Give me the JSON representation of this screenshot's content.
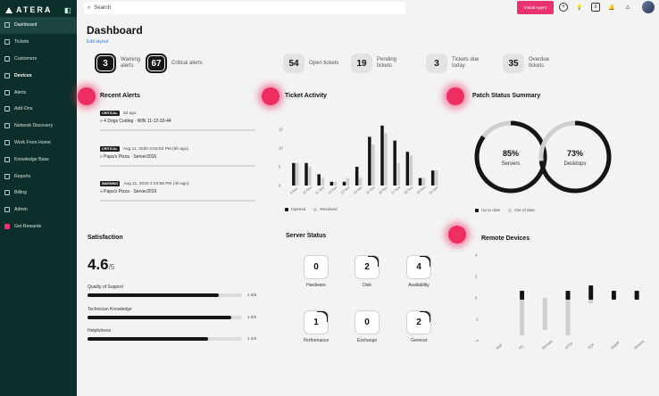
{
  "app": {
    "logo_text": "ATERA"
  },
  "sidebar": {
    "items": [
      {
        "label": "Dashboard",
        "icon": "grid-icon",
        "active": true
      },
      {
        "label": "Tickets",
        "icon": "ticket-icon"
      },
      {
        "label": "Customers",
        "icon": "users-icon"
      },
      {
        "label": "Devices",
        "icon": "monitor-icon",
        "bold": true
      },
      {
        "label": "Alerts",
        "icon": "warning-icon"
      },
      {
        "label": "Add-Ons",
        "icon": "puzzle-icon"
      },
      {
        "label": "Network Discovery",
        "icon": "network-icon"
      },
      {
        "label": "Work From Home",
        "icon": "home-icon"
      },
      {
        "label": "Knowledge Base",
        "icon": "book-icon"
      },
      {
        "label": "Reports",
        "icon": "chart-icon"
      },
      {
        "label": "Billing",
        "icon": "invoice-icon"
      },
      {
        "label": "Admin",
        "icon": "gear-icon"
      },
      {
        "label": "Get Rewards",
        "icon": "gift-icon",
        "pink": true
      }
    ]
  },
  "topbar": {
    "search_label": "Search",
    "install_label": "Install Agent",
    "icons": [
      "plus-circle-icon",
      "lightbulb-icon",
      "chat-icon",
      "bell-icon",
      "warning-icon"
    ]
  },
  "page": {
    "title": "Dashboard",
    "edit_layout": "Edit layout"
  },
  "stats": [
    {
      "value": "3",
      "label": "Warning alerts",
      "dark": true
    },
    {
      "value": "67",
      "label": "Critical alerts",
      "dark": true
    },
    {
      "value": "54",
      "label": "Open tickets"
    },
    {
      "value": "19",
      "label": "Pending tickets"
    },
    {
      "value": "3",
      "label": "Tickets due today"
    },
    {
      "value": "35",
      "label": "Overdue tickets"
    }
  ],
  "recent_alerts": {
    "title": "Recent Alerts",
    "items": [
      {
        "badge": "CRITICAL",
        "time": "3d ago",
        "desc": "» 4 Dogs Coding · WIN 11-12-33-44"
      },
      {
        "badge": "CRITICAL",
        "time": "Aug 11, 2020 4:03:58 PM (5h ago)",
        "desc": "» Papa's Pizza · Server2016"
      },
      {
        "badge": "WARNING",
        "time": "Aug 11, 2020 4:03:58 PM (4h ago)",
        "desc": "» Papa's Pizza · Server2019"
      }
    ]
  },
  "ticket_activity": {
    "title": "Ticket Activity",
    "legend": [
      "Opened",
      "Resolved"
    ]
  },
  "patch_status": {
    "title": "Patch Status Summary",
    "rings": [
      {
        "percent": "85%",
        "label": "Servers",
        "value": 0.85
      },
      {
        "percent": "73%",
        "label": "Desktops",
        "value": 0.73
      }
    ],
    "legend": [
      "Up to date",
      "Out of date"
    ]
  },
  "satisfaction": {
    "title": "Satisfaction",
    "score": "4.6",
    "denominator": "/5",
    "metrics": [
      {
        "label": "Quality of Support",
        "value": "4.6/5",
        "fraction": 0.85
      },
      {
        "label": "Technician Knowledge",
        "value": "4.8/5",
        "fraction": 0.93
      },
      {
        "label": "Helpfulness",
        "value": "4.4/5",
        "fraction": 0.78
      }
    ]
  },
  "server_status": {
    "title": "Server Status",
    "cards": [
      {
        "value": "0",
        "label": "Hardware"
      },
      {
        "value": "2",
        "label": "Disk",
        "arc": true
      },
      {
        "value": "4",
        "label": "Availability",
        "arc": true
      },
      {
        "value": "1",
        "label": "Performance",
        "arc": true
      },
      {
        "value": "0",
        "label": "Exchange"
      },
      {
        "value": "2",
        "label": "General",
        "arc": true
      }
    ]
  },
  "remote_devices": {
    "title": "Remote Devices"
  },
  "colors": {
    "accent": "#e8336f",
    "sidebar": "#0d2f2b",
    "dark": "#151515"
  },
  "chart_data": [
    {
      "type": "bar",
      "title": "Ticket Activity",
      "categories": [
        "9 Nov",
        "10 Nov",
        "11 Nov",
        "12 Nov",
        "13 Nov",
        "14 Nov",
        "15 Nov",
        "16 Nov",
        "17 Nov",
        "18 Nov",
        "19 Nov",
        "20 Nov"
      ],
      "series": [
        {
          "name": "Opened",
          "values": [
            6,
            6,
            3,
            1,
            1,
            5,
            13,
            16,
            12,
            9,
            2,
            4
          ]
        },
        {
          "name": "Resolved",
          "values": [
            6,
            5,
            2,
            1,
            2,
            2,
            11,
            14,
            6,
            8,
            2,
            4
          ]
        }
      ],
      "yticks": [
        "0",
        "5",
        "10",
        "15"
      ],
      "ylim": [
        0,
        20
      ]
    },
    {
      "type": "bar",
      "title": "Remote Devices",
      "categories": [
        "Mail",
        "PC",
        "Remote",
        "HTTP",
        "TCP",
        "SNMP",
        "Generic"
      ],
      "series": [
        {
          "name": "",
          "values": [
            0,
            0.5,
            0,
            0.5,
            1,
            0.5,
            0.5
          ]
        },
        {
          "name": "",
          "values": [
            0,
            -3.5,
            -3,
            -3.5,
            -0.5,
            0,
            0
          ]
        }
      ],
      "yticks": [
        "4",
        "2",
        "0",
        "-2",
        "-4"
      ],
      "ylim": [
        -4,
        4
      ]
    }
  ]
}
